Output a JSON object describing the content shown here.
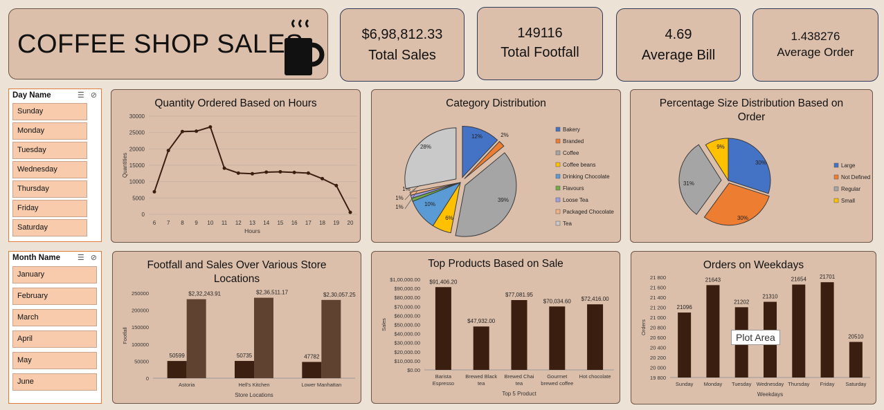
{
  "header": {
    "title": "COFFEE SHOP SALES",
    "icon": "coffee-mug-icon"
  },
  "kpis": [
    {
      "value": "$6,98,812.33",
      "label": "Total Sales"
    },
    {
      "value": "149116",
      "label": "Total Footfall"
    },
    {
      "value": "4.69",
      "label": "Average Bill"
    },
    {
      "value": "1.438276",
      "label": "Average Order"
    }
  ],
  "slicers": {
    "day": {
      "title": "Day Name",
      "items": [
        "Sunday",
        "Monday",
        "Tuesday",
        "Wednesday",
        "Thursday",
        "Friday",
        "Saturday"
      ]
    },
    "month": {
      "title": "Month Name",
      "items": [
        "January",
        "February",
        "March",
        "April",
        "May",
        "June"
      ]
    }
  },
  "tooltip": "Plot Area",
  "chart_data": [
    {
      "type": "line",
      "title": "Quantity Ordered Based on Hours",
      "xlabel": "Hours",
      "ylabel": "Quantities",
      "x": [
        6,
        7,
        8,
        9,
        10,
        11,
        12,
        13,
        14,
        15,
        16,
        17,
        18,
        19,
        20
      ],
      "values": [
        6900,
        19500,
        25300,
        25400,
        26700,
        14100,
        12600,
        12400,
        12900,
        13000,
        12800,
        12600,
        10900,
        8800,
        600
      ],
      "ylim": [
        0,
        30000
      ],
      "yticks": [
        "0",
        "5000",
        "10000",
        "15000",
        "20000",
        "25000",
        "30000"
      ],
      "color": "#3a1e10"
    },
    {
      "type": "pie",
      "title": "Category Distribution",
      "labels": [
        "Bakery",
        "Branded",
        "Coffee",
        "Coffee beans",
        "Drinking Chocolate",
        "Flavours",
        "Loose Tea",
        "Packaged Chocolate",
        "Tea"
      ],
      "values": [
        12,
        2,
        39,
        6,
        10,
        1,
        1,
        1,
        28
      ],
      "data_labels": [
        "12%",
        "2%",
        "39%",
        "6%",
        "10%",
        "1%",
        "1%",
        "1%",
        "28%"
      ],
      "colors": [
        "#4472c4",
        "#ed7d31",
        "#a5a5a5",
        "#ffc000",
        "#5b9bd5",
        "#70ad47",
        "#9e9ee0",
        "#f4b183",
        "#c9c9c9"
      ]
    },
    {
      "type": "pie",
      "title": "Percentage Size Distribution Based on Order",
      "labels": [
        "Large",
        "Not Defined",
        "Regular",
        "Small"
      ],
      "values": [
        30,
        30,
        31,
        9
      ],
      "data_labels": [
        "30%",
        "30%",
        "31%",
        "9%"
      ],
      "colors": [
        "#4472c4",
        "#ed7d31",
        "#a5a5a5",
        "#ffc000"
      ]
    },
    {
      "type": "bar",
      "title": "Footfall and Sales Over Various Store Locations",
      "xlabel": "Store Locations",
      "ylabel": "Footfall",
      "categories": [
        "Astoria",
        "Hell's Kitchen",
        "Lower Manhattan"
      ],
      "series": [
        {
          "values": [
            50599,
            50735,
            47782
          ],
          "labels": [
            "50599",
            "50735",
            "47782"
          ],
          "color": "#3b1f10"
        },
        {
          "values": [
            232243.91,
            236511.17,
            230057.25
          ],
          "labels": [
            "$2,32,243.91",
            "$2,36,511.17",
            "$2,30,057.25"
          ],
          "color": "#5f4330"
        }
      ],
      "ylim": [
        0,
        250000
      ],
      "yticks": [
        "0",
        "50000",
        "100000",
        "150000",
        "200000",
        "250000"
      ]
    },
    {
      "type": "bar",
      "title": "Top Products Based on Sale",
      "xlabel": "Top 5 Product",
      "ylabel": "Sales",
      "categories": [
        "Barista Espresso",
        "Brewed Black tea",
        "Brewed Chai tea",
        "Gourmet brewed coffee",
        "Hot chocolate"
      ],
      "values": [
        91406.2,
        47932.0,
        77081.95,
        70034.6,
        72416.0
      ],
      "labels": [
        "$91,406.20",
        "$47,932.00",
        "$77,081.95",
        "$70,034.60",
        "$72,416.00"
      ],
      "ylim": [
        0,
        100000
      ],
      "yticks": [
        "$0.00",
        "$10,000.00",
        "$20,000.00",
        "$30,000.00",
        "$40,000.00",
        "$50,000.00",
        "$60,000.00",
        "$70,000.00",
        "$80,000.00",
        "$90,000.00",
        "$1,00,000.00"
      ],
      "color": "#3a1e10"
    },
    {
      "type": "bar",
      "title": "Orders on Weekdays",
      "xlabel": "Weekdays",
      "ylabel": "Orders",
      "categories": [
        "Sunday",
        "Monday",
        "Tuesday",
        "Wednesday",
        "Thursday",
        "Friday",
        "Saturday"
      ],
      "values": [
        21096,
        21643,
        21202,
        21310,
        21654,
        21701,
        20510
      ],
      "labels": [
        "21096",
        "21643",
        "21202",
        "21310",
        "21654",
        "21701",
        "20510"
      ],
      "ylim": [
        19800,
        21800
      ],
      "yticks": [
        "19 800",
        "20 000",
        "20 200",
        "20 400",
        "20 600",
        "20 800",
        "21 000",
        "21 200",
        "21 400",
        "21 600",
        "21 800"
      ],
      "color": "#3a1e10"
    }
  ]
}
